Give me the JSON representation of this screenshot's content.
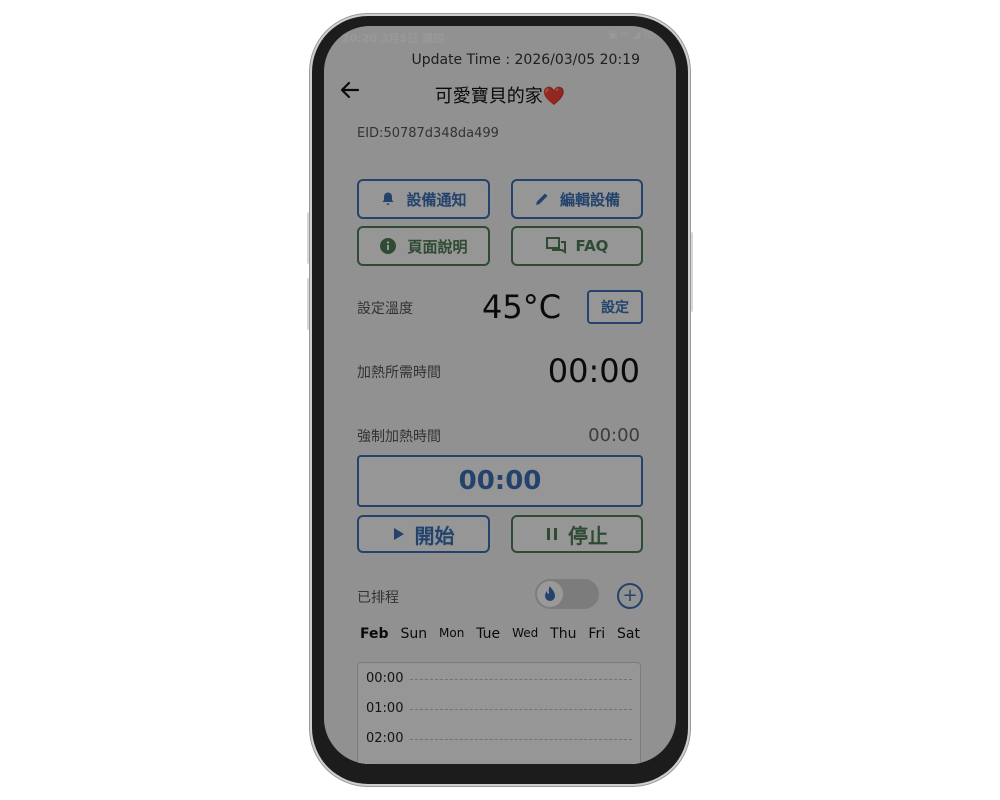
{
  "status_bar": {
    "time": "20:20 3月5日 週四",
    "icons": "▣ ✉ ◢ 85"
  },
  "header": {
    "update_time": "Update Time : 2026/03/05 20:19",
    "title": "可愛寶貝的家❤️",
    "back_icon": "arrow-left"
  },
  "device": {
    "eid": "EID:50787d348da499"
  },
  "actions": {
    "notify": "設備通知",
    "edit": "編輯設備",
    "help": "頁面說明",
    "faq": "FAQ"
  },
  "temperature": {
    "label": "設定溫度",
    "value": "45°C",
    "set_button": "設定"
  },
  "heating_time": {
    "label": "加熱所需時間",
    "value": "00:00"
  },
  "forced_heating": {
    "label": "強制加熱時間",
    "value": "00:00",
    "timer": "00:00"
  },
  "controls": {
    "start": "開始",
    "stop": "停止"
  },
  "schedule": {
    "label": "已排程",
    "toggle_on": false,
    "days": [
      "Feb",
      "Sun",
      "Mon",
      "Tue",
      "Wed",
      "Thu",
      "Fri",
      "Sat"
    ],
    "hours": [
      "00:00",
      "01:00",
      "02:00"
    ]
  },
  "colors": {
    "accent": "#3b70b5",
    "secondary": "#4f7d55",
    "overlay": "rgba(0,0,0,0.40)"
  }
}
